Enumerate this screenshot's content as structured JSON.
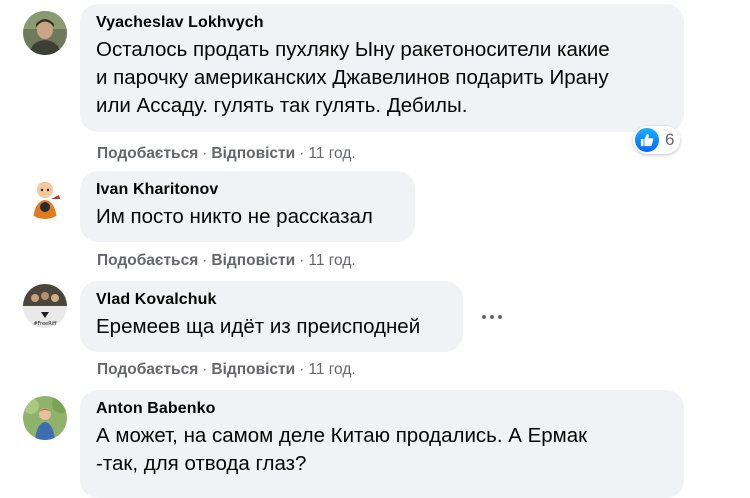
{
  "actions": {
    "like": "Подобається",
    "reply": "Відповісти",
    "separator": "·"
  },
  "comments": [
    {
      "author": "Vyacheslav Lokhvych",
      "lines": [
        "Осталось продать пухляку Ыну ракетоносители какие",
        "и парочку американских Джавелинов подарить Ирану",
        "или Ассаду. гулять так гулять. Дебилы."
      ],
      "time": "11 год.",
      "reactions": {
        "icon": "like-icon",
        "count": "6"
      }
    },
    {
      "author": "Ivan Kharitonov",
      "lines": [
        "Им посто никто не рассказал"
      ],
      "time": "11 год."
    },
    {
      "author": "Vlad Kovalchuk",
      "lines": [
        "Еремеев ща идёт из преисподней"
      ],
      "time": "11 год.",
      "avatar_text": "#FreeRiff"
    },
    {
      "author": "Anton Babenko",
      "lines": [
        "А может, на самом деле Китаю продались. А Ермак",
        "-так, для отвода глаз?"
      ]
    }
  ],
  "colors": {
    "bubble": "#f0f2f5",
    "secondary_text": "#65676b",
    "primary_text": "#050505",
    "like_blue": "#0866ff"
  }
}
